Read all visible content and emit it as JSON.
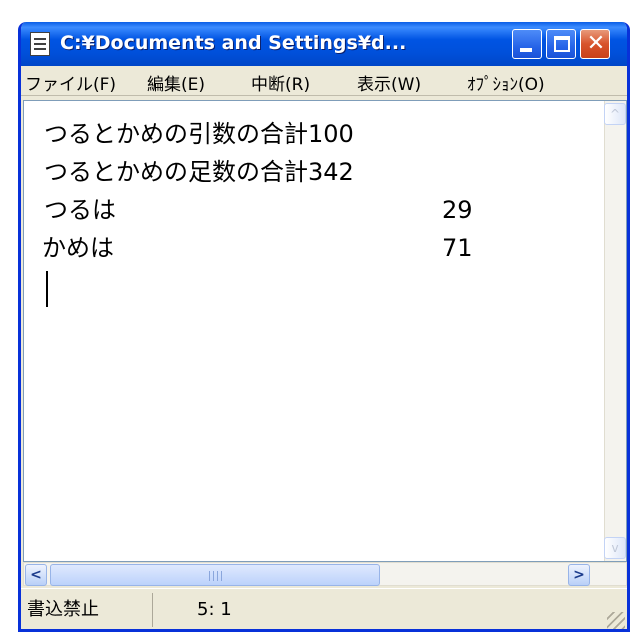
{
  "window": {
    "title": "C:¥Documents and Settings¥d...",
    "icon": "notepad-icon"
  },
  "menu": [
    {
      "label": "ファイル(F)"
    },
    {
      "label": "編集(E)"
    },
    {
      "label": "中断(R)"
    },
    {
      "label": "表示(W)"
    },
    {
      "label": "ｵﾌﾟｼｮﾝ(O)"
    }
  ],
  "content": {
    "lines": [
      {
        "text": "つるとかめの引数の合計100",
        "value": ""
      },
      {
        "text": "つるとかめの足数の合計342",
        "value": ""
      },
      {
        "text": "つるは",
        "value": "29"
      },
      {
        "text": "かめは",
        "value": "71"
      }
    ]
  },
  "scrollbar": {
    "left_arrow": "<",
    "right_arrow": ">",
    "up_arrow": "^",
    "down_arrow": "v"
  },
  "status": {
    "mode": "書込禁止",
    "position": "5:  1"
  },
  "colors": {
    "titlebar": "#0054e3",
    "close_button": "#d8542c",
    "chrome": "#ece9d8"
  }
}
